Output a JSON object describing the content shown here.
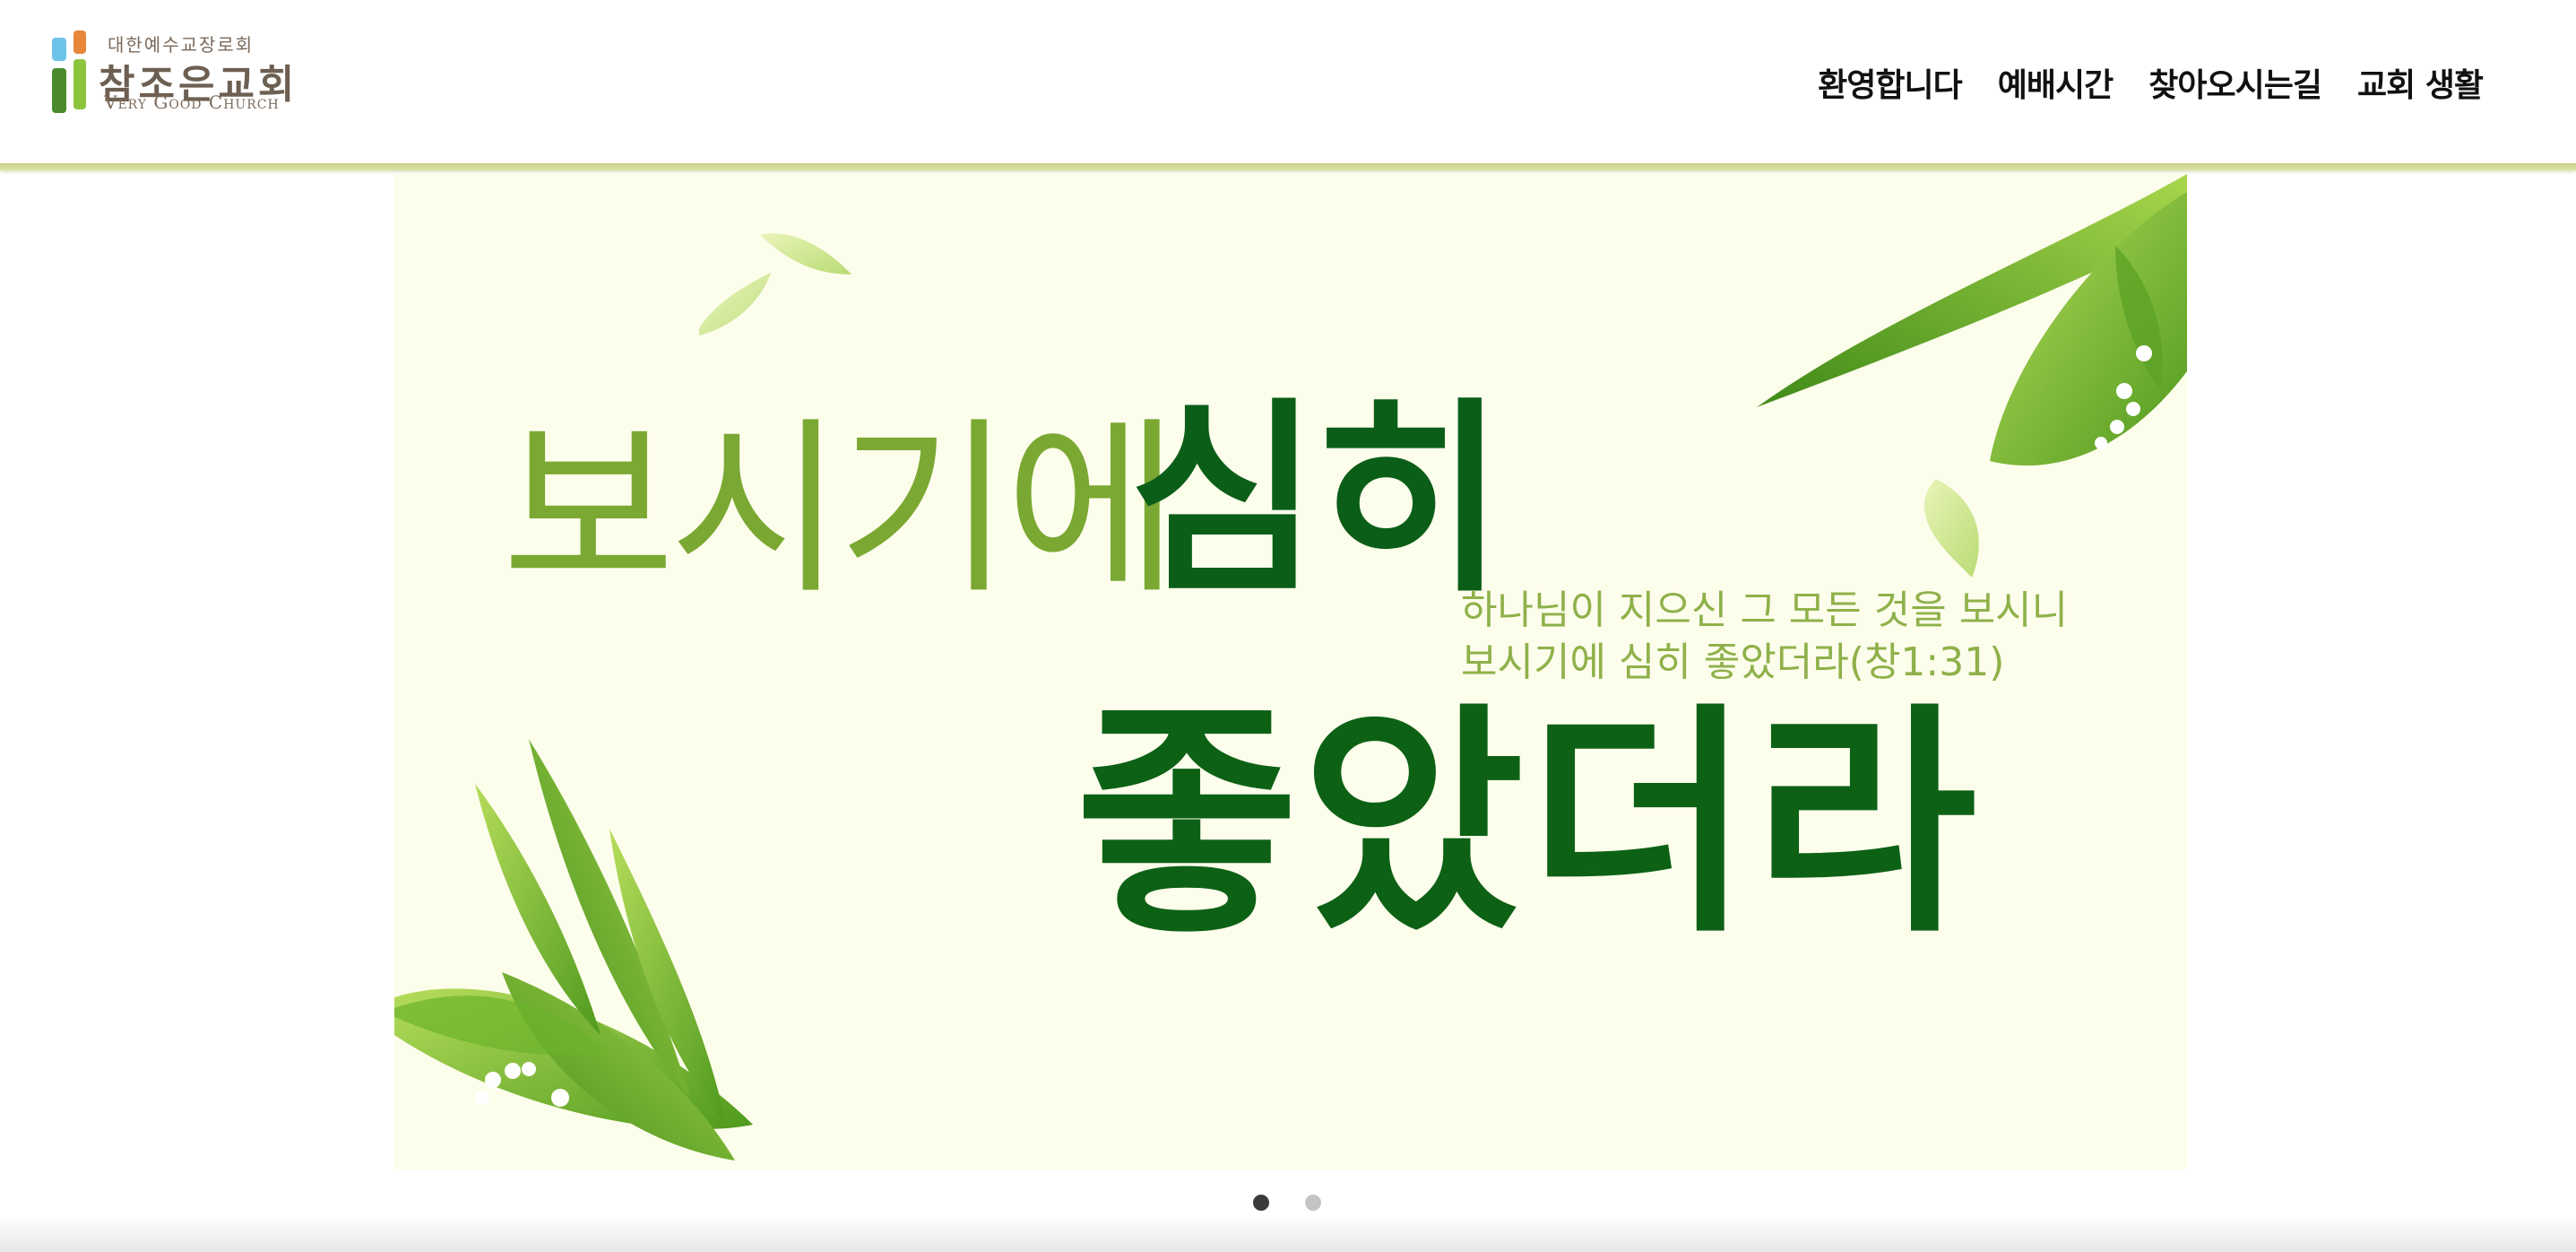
{
  "header": {
    "logo": {
      "subtitle": "대한예수교장로회",
      "name": "참조은교회",
      "english": "Very Good Church",
      "colors": [
        "#6cc4e8",
        "#e8863a",
        "#8cc43c",
        "#4a8a2a"
      ]
    },
    "nav": [
      {
        "label": "환영합니다"
      },
      {
        "label": "예배시간"
      },
      {
        "label": "찾아오시는길"
      },
      {
        "label": "교회 생활"
      }
    ],
    "rule_color": "#cfd593"
  },
  "banner": {
    "headline_light": "보시기에",
    "headline_dark": "심히",
    "verse_line1": "하나님이 지으신 그 모든 것을 보시니",
    "verse_line2": "보시기에 심히 좋았더라(창1:31)",
    "headline_big": "좋았더라",
    "colors": {
      "background": "#fdfdec",
      "light_green": "#7aa832",
      "dark_green": "#0b5e17",
      "verse": "#8fb14a"
    }
  },
  "pager": {
    "total": 2,
    "active_index": 0
  }
}
